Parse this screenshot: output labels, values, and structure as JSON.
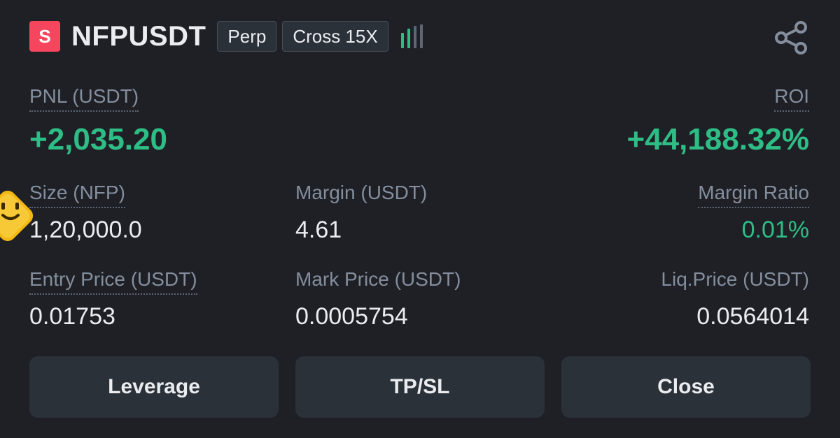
{
  "header": {
    "side_badge": "S",
    "symbol": "NFPUSDT",
    "contract_type": "Perp",
    "margin_mode": "Cross 15X",
    "signal_icon": "risk-bars-icon",
    "share_icon": "share-icon"
  },
  "pnl": {
    "label": "PNL (USDT)",
    "value": "+2,035.20"
  },
  "roi": {
    "label": "ROI",
    "value": "+44,188.32%"
  },
  "size": {
    "label": "Size (NFP)",
    "value": "1,20,000.0"
  },
  "margin": {
    "label": "Margin (USDT)",
    "value": "4.61"
  },
  "margin_ratio": {
    "label": "Margin Ratio",
    "value": "0.01%"
  },
  "entry_price": {
    "label": "Entry Price (USDT)",
    "value": "0.01753"
  },
  "mark_price": {
    "label": "Mark Price (USDT)",
    "value": "0.0005754"
  },
  "liq_price": {
    "label": "Liq.Price (USDT)",
    "value": "0.0564014"
  },
  "buttons": {
    "leverage": "Leverage",
    "tpsl": "TP/SL",
    "close": "Close"
  },
  "colors": {
    "background": "#1e2026",
    "profit": "#2ebd85",
    "short": "#f6465d",
    "button": "#2b3139"
  }
}
